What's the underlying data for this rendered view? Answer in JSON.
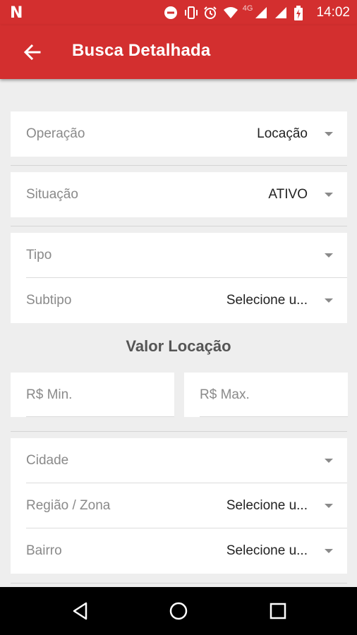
{
  "status_bar": {
    "network_type": "4G",
    "time": "14:02"
  },
  "app_bar": {
    "title": "Busca Detalhada"
  },
  "form": {
    "operacao": {
      "label": "Operação",
      "value": "Locação"
    },
    "situacao": {
      "label": "Situação",
      "value": "ATIVO"
    },
    "tipo": {
      "label": "Tipo",
      "value": ""
    },
    "subtipo": {
      "label": "Subtipo",
      "value": "Selecione u..."
    },
    "valor_section_title": "Valor Locação",
    "min_placeholder": "R$ Min.",
    "max_placeholder": "R$ Max.",
    "cidade": {
      "label": "Cidade",
      "value": ""
    },
    "regiao": {
      "label": "Região / Zona",
      "value": "Selecione u..."
    },
    "bairro": {
      "label": "Bairro",
      "value": "Selecione u..."
    }
  },
  "icons": {
    "notification": "n-notification-icon",
    "dnd": "do-not-disturb-icon",
    "vibrate": "vibrate-icon",
    "alarm": "alarm-icon",
    "wifi": "wifi-icon",
    "signal": "signal-icon",
    "battery": "battery-charging-icon",
    "back": "arrow-back-icon",
    "dropdown": "caret-down-icon",
    "nav_back": "triangle-back-icon",
    "nav_home": "circle-home-icon",
    "nav_recents": "square-recents-icon"
  },
  "colors": {
    "primary": "#d32f2f",
    "background": "#eeeeee",
    "label": "#8a8a8a",
    "value": "#222222"
  }
}
